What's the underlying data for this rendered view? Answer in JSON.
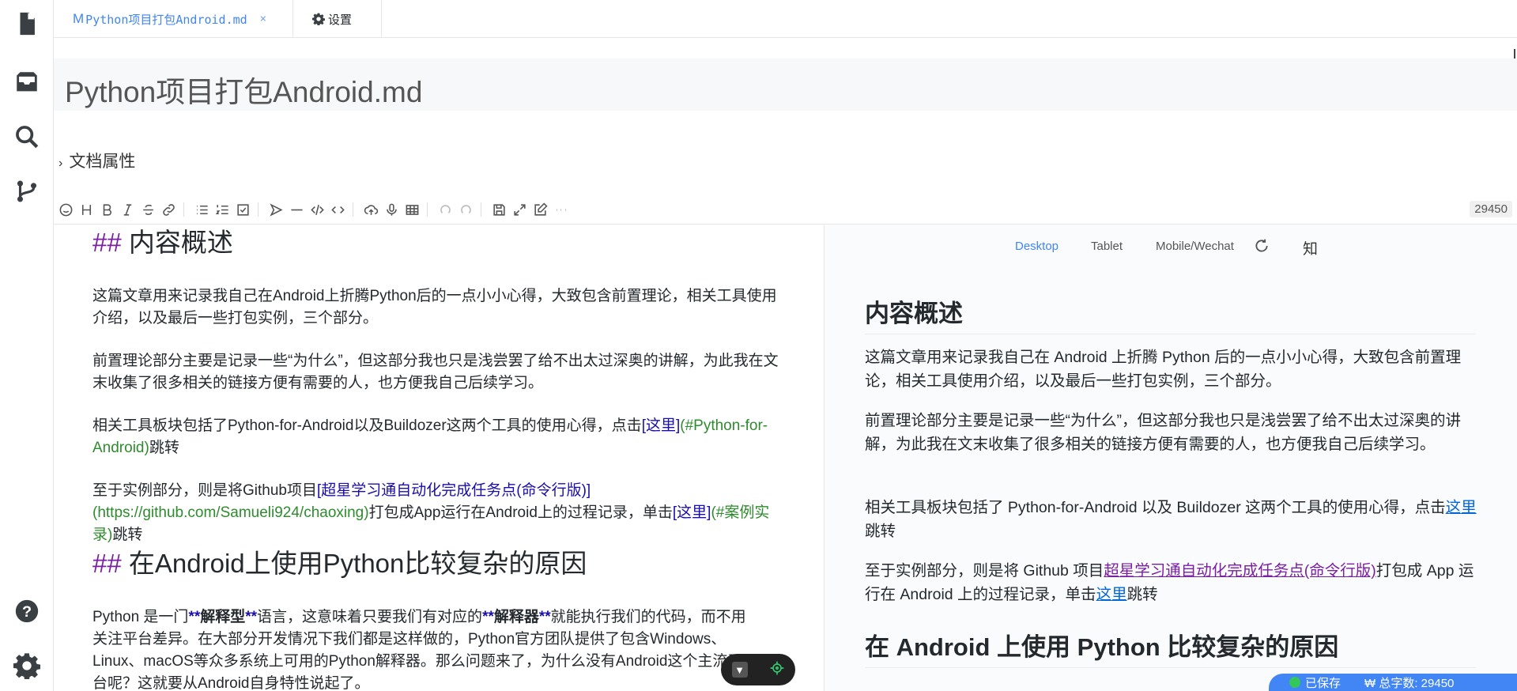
{
  "tabs": [
    {
      "mark": "M",
      "label": "Python项目打包Android.md",
      "close": "×"
    },
    {
      "label": "设置"
    }
  ],
  "sidebar": [
    "file-icon",
    "inbox-icon",
    "search-icon",
    "git-branch-icon",
    "help-icon",
    "settings-icon"
  ],
  "title": "Python项目打包Android.md",
  "doc_props": {
    "chevron": "›",
    "label": "文档属性"
  },
  "toolbar": {
    "word_count": "29450"
  },
  "editor": {
    "h1_hash": "##",
    "h1_text": "内容概述",
    "p1": "这篇文章用来记录我自己在Android上折腾Python后的一点小小心得，大致包含前置理论，相关工具使用介绍，以及最后一些打包实例，三个部分。",
    "p2": "前置理论部分主要是记录一些“为什么”，但这部分我也只是浅尝罢了给不出太过深奥的讲解，为此我在文末收集了很多相关的链接方便有需要的人，也方便我自己后续学习。",
    "p3_pre": "相关工具板块包括了Python-for-Android以及Buildozer这两个工具的使用心得，点击",
    "p3_link": "[这里]",
    "p3_url": "(#Python-for-Android)",
    "p3_post": "跳转",
    "p4_pre": "至于实例部分，则是将Github项目",
    "p4_link": "[超星学习通自动化完成任务点(命令行版)]",
    "p4_url": "(https://github.com/Samueli924/chaoxing)",
    "p4_mid": "打包成App运行在Android上的过程记录，单击",
    "p4_link2": "[这里]",
    "p4_url2": "(#案例实录)",
    "p4_post": "跳转",
    "h2_hash": "##",
    "h2_text": "在Android上使用Python比较复杂的原因",
    "p5_a": "Python 是一门",
    "p5_b1": "**",
    "p5_b": "解释型",
    "p5_c": "语言，这意味着只要我们有对应的",
    "p5_d": "解释器",
    "p5_e": "就能执行我们的代码，而不用关注平台差异。在大部分开发情况下我们都是这样做的，Python官方团队提供了包含Windows、Linux、macOS等众多系统上可用的Python解释器。那么问题来了，为什么没有Android这个主流平台呢？这就要从Android自身特性说起了。"
  },
  "preview": {
    "tabs": [
      "Desktop",
      "Tablet",
      "Mobile/Wechat",
      "知"
    ],
    "h1": "内容概述",
    "p1": "这篇文章用来记录我自己在 Android 上折腾 Python 后的一点小小心得，大致包含前置理论，相关工具使用介绍，以及最后一些打包实例，三个部分。",
    "p2": "前置理论部分主要是记录一些“为什么”，但这部分我也只是浅尝罢了给不出太过深奥的讲解，为此我在文末收集了很多相关的链接方便有需要的人，也方便我自己后续学习。",
    "p3_pre": "相关工具板块包括了 Python-for-Android 以及 Buildozer 这两个工具的使用心得，点击",
    "p3_link": "这里",
    "p3_post": "跳转",
    "p4_pre": "至于实例部分，则是将 Github 项目",
    "p4_link": "超星学习通自动化完成任务点(命令行版)",
    "p4_mid": "打包成 App 运行在 Android 上的过程记录，单击",
    "p4_link2": "这里",
    "p4_post": "跳转",
    "h2": "在 Android 上使用 Python 比较复杂的原因"
  },
  "status": {
    "saved": "已保存",
    "words": "₩ 总字数: 29450"
  },
  "colors": {
    "accent": "#4285f4",
    "heading_mark": "#7b1fa2",
    "link": "#1a0dab",
    "url": "#2e8b2e"
  }
}
